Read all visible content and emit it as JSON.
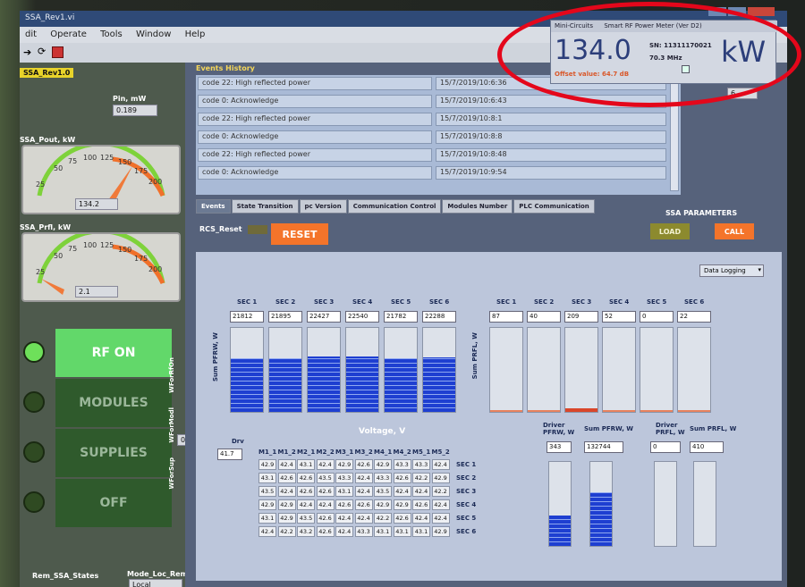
{
  "window": {
    "title": "SSA_Rev1.vi",
    "menu": [
      "dit",
      "Operate",
      "Tools",
      "Window",
      "Help"
    ]
  },
  "left": {
    "vi_name": "SSA_Rev1.0",
    "pin_label": "Pin, mW",
    "pin_value": "0.189",
    "pout_label": "SSA_Pout, kW",
    "pout_ticks": [
      "25",
      "50",
      "75",
      "100",
      "125",
      "150",
      "175",
      "200"
    ],
    "pout_value": "134.2",
    "prfl_label": "SSA_Prfl, kW",
    "prfl_ticks": [
      "25",
      "50",
      "75",
      "100",
      "125",
      "150",
      "175",
      "200"
    ],
    "prfl_value": "2.1",
    "buttons": {
      "rf_on": "RF ON",
      "modules": "MODULES",
      "supplies": "SUPPLIES",
      "off": "OFF"
    },
    "vlabels": [
      "WForRfOn",
      "WForModl",
      "WForSup"
    ],
    "sup_value": "0",
    "rem_label": "Rem_SSA_States",
    "mode_label": "Mode_Loc_Rem",
    "mode_value": "Local"
  },
  "events": {
    "header": "Events History",
    "rows": [
      {
        "msg": "code 22: High reflected power",
        "time": "15/7/2019/10:6:36"
      },
      {
        "msg": "code 0: Acknowledge",
        "time": "15/7/2019/10:6:43"
      },
      {
        "msg": "code 22: High reflected power",
        "time": "15/7/2019/10:8:1"
      },
      {
        "msg": "code 0: Acknowledge",
        "time": "15/7/2019/10:8:8"
      },
      {
        "msg": "code 22: High reflected power",
        "time": "15/7/2019/10:8:48"
      },
      {
        "msg": "code 0: Acknowledge",
        "time": "15/7/2019/10:9:54"
      }
    ],
    "side_value": "6",
    "tabs": [
      "Events",
      "State Transition",
      "pc Version",
      "Communication Control",
      "Modules Number",
      "PLC Communication"
    ]
  },
  "controls": {
    "rcs_reset_label": "RCS_Reset",
    "reset_button": "RESET",
    "ssa_params": "SSA PARAMETERS",
    "load_button": "LOAD",
    "call_button": "CALL",
    "data_logging": "Data Logging"
  },
  "power_meter": {
    "brand": "Mini-Circuits",
    "title": "Smart RF Power Meter (Ver D2)",
    "value": "134.0",
    "unit": "kW",
    "sn": "SN: 11311170021",
    "freq": "70.3 MHz",
    "offset": "Offset value: 64.7 dB"
  },
  "sections": {
    "headers": [
      "SEC 1",
      "SEC 2",
      "SEC 3",
      "SEC 4",
      "SEC 5",
      "SEC 6"
    ],
    "pfrw_label": "Sum PFRW, W",
    "pfrw_values": [
      "21812",
      "21895",
      "22427",
      "22540",
      "21782",
      "22288"
    ],
    "pfrw_fill": [
      0.62,
      0.63,
      0.65,
      0.65,
      0.62,
      0.64
    ],
    "prfl_label": "Sum PRFL, W",
    "prfl_values": [
      "87",
      "40",
      "209",
      "52",
      "0",
      "22"
    ],
    "prfl_fill": [
      0.01,
      0.01,
      0.04,
      0.01,
      0.0,
      0.01
    ]
  },
  "voltage": {
    "title": "Voltage, V",
    "drv_label": "Drv",
    "drv_value": "41.7",
    "cols": [
      "M1_1",
      "M1_2",
      "M2_1",
      "M2_2",
      "M3_1",
      "M3_2",
      "M4_1",
      "M4_2",
      "M5_1",
      "M5_2"
    ],
    "rows": [
      "SEC 1",
      "SEC 2",
      "SEC 3",
      "SEC 4",
      "SEC 5",
      "SEC 6"
    ],
    "cells": [
      [
        "42.9",
        "42.4",
        "43.1",
        "42.4",
        "42.9",
        "42.6",
        "42.9",
        "43.3",
        "43.3",
        "42.4"
      ],
      [
        "43.1",
        "42.6",
        "42.6",
        "43.5",
        "43.3",
        "42.4",
        "43.3",
        "42.6",
        "42.2",
        "42.9"
      ],
      [
        "43.5",
        "42.4",
        "42.6",
        "42.6",
        "43.1",
        "42.4",
        "43.5",
        "42.4",
        "42.4",
        "42.2"
      ],
      [
        "42.9",
        "42.9",
        "42.4",
        "42.4",
        "42.6",
        "42.6",
        "42.9",
        "42.9",
        "42.6",
        "42.4"
      ],
      [
        "43.1",
        "42.9",
        "43.5",
        "42.6",
        "42.4",
        "42.4",
        "42.2",
        "42.6",
        "42.4",
        "42.4"
      ],
      [
        "42.4",
        "42.2",
        "43.2",
        "42.6",
        "42.4",
        "43.3",
        "43.1",
        "43.1",
        "43.1",
        "42.9"
      ]
    ]
  },
  "totals": {
    "driver_pfrw_label": "Driver PFRW, W",
    "driver_pfrw_value": "343",
    "driver_pfrw_fill": 0.35,
    "sum_pfrw_label": "Sum PFRW, W",
    "sum_pfrw_value": "132744",
    "sum_pfrw_fill": 0.62,
    "driver_prfl_label": "Driver PRFL, W",
    "driver_prfl_value": "0",
    "driver_prfl_fill": 0.0,
    "sum_prfl_label": "Sum PRFL, W",
    "sum_prfl_value": "410",
    "sum_prfl_fill": 0.0
  },
  "colors": {
    "accent_orange": "#f4742a",
    "led_green": "#6ee05a",
    "bar_blue": "#1e3fd1",
    "highlight_ring": "#e4071b"
  }
}
